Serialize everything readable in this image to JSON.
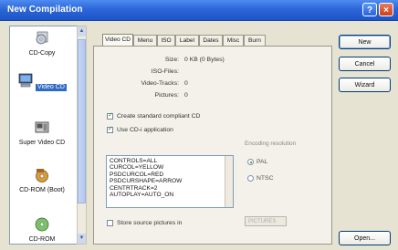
{
  "window": {
    "title": "New Compilation"
  },
  "titlebar": {
    "help_label": "?",
    "close_label": "×"
  },
  "sidebar": {
    "items": [
      {
        "label": "CD-Copy",
        "icon": "cd-copy-icon",
        "selected": false
      },
      {
        "label": "Video CD",
        "icon": "video-cd-icon",
        "selected": true
      },
      {
        "label": "Super Video CD",
        "icon": "super-video-cd-icon",
        "selected": false
      },
      {
        "label": "CD-ROM (Boot)",
        "icon": "cd-rom-boot-icon",
        "selected": false
      },
      {
        "label": "CD-ROM",
        "icon": "cd-rom-icon",
        "selected": false
      }
    ],
    "scroll_up": "▲",
    "scroll_down": "▼"
  },
  "tabs": [
    {
      "label": "Video CD",
      "active": true
    },
    {
      "label": "Menu",
      "active": false
    },
    {
      "label": "ISO",
      "active": false
    },
    {
      "label": "Label",
      "active": false
    },
    {
      "label": "Dates",
      "active": false
    },
    {
      "label": "Misc",
      "active": false
    },
    {
      "label": "Burn",
      "active": false
    }
  ],
  "info": {
    "size_label": "Size:",
    "size_value": "0 KB (0 Bytes)",
    "iso_label": "ISO-Files:",
    "iso_value": "",
    "tracks_label": "Video-Tracks:",
    "tracks_value": "0",
    "pictures_label": "Pictures:",
    "pictures_value": "0"
  },
  "options": {
    "compliant_label": "Create standard compliant CD",
    "compliant_checked": true,
    "cdi_label": "Use CD-i application",
    "cdi_checked": true,
    "store_label": "Store source pictures in",
    "store_checked": false
  },
  "config_lines": [
    "CONTROLS=ALL",
    "CURCOL=YELLOW",
    "PSDCURCOL=RED",
    "PSDCURSHAPE=ARROW",
    "CENTRTRACK=2",
    "AUTOPLAY=AUTO_ON"
  ],
  "encoding": {
    "label": "Encoding resolution",
    "pal_label": "PAL",
    "pal_selected": true,
    "ntsc_label": "NTSC",
    "ntsc_selected": false
  },
  "pictures_field": {
    "value": "PICTURES"
  },
  "buttons": {
    "new": "New",
    "cancel": "Cancel",
    "wizard": "Wizard",
    "open": "Open..."
  },
  "colors": {
    "titlebar": "#2c66d8",
    "selection": "#316ac5",
    "dialog_bg": "#e6e3d3"
  }
}
